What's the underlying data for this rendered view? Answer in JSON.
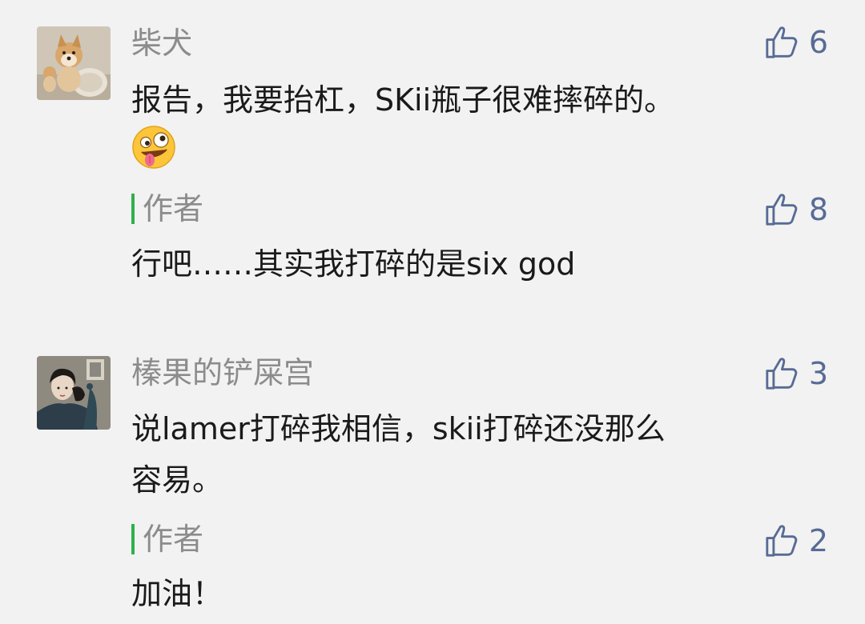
{
  "comments": [
    {
      "username": "柴犬",
      "avatar": "shiba-dog-photo",
      "likes": "6",
      "text": "报告，我要抬杠，SKii瓶子很难摔碎的。",
      "emoji": "zany-face-emoji",
      "reply": {
        "author_label": "作者",
        "likes": "8",
        "text": "行吧……其实我打碎的是six god"
      }
    },
    {
      "username": "榛果的铲屎宫",
      "avatar": "woman-portrait-painting",
      "likes": "3",
      "text_line1": "说lamer打碎我相信，skii打碎还没那么",
      "text_line2": "容易。",
      "reply": {
        "author_label": "作者",
        "likes": "2",
        "text": "加油！"
      }
    }
  ],
  "colors": {
    "background": "#f2f2f2",
    "username": "#8c8c8c",
    "like": "#576b95",
    "author_bar": "#2fb14b",
    "text": "#1a1a1a"
  },
  "icons": {
    "like": "thumbs-up-outline-icon"
  }
}
